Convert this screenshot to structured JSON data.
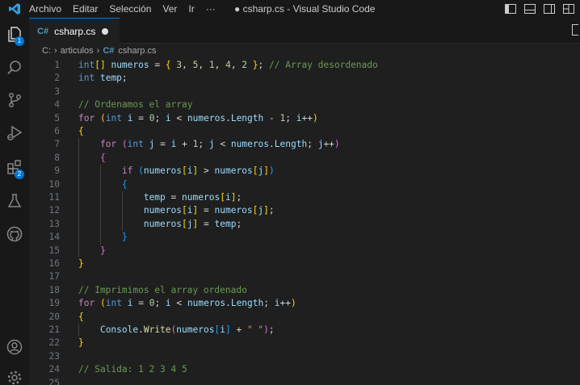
{
  "window": {
    "title": "● csharp.cs - Visual Studio Code"
  },
  "menu": {
    "items": [
      "Archivo",
      "Editar",
      "Selección",
      "Ver",
      "Ir",
      "···"
    ]
  },
  "activity": {
    "explorer_badge": "1",
    "extensions_badge": "2",
    "icons": [
      "files-icon",
      "search-icon",
      "source-control-icon",
      "run-debug-icon",
      "extensions-icon",
      "testing-icon",
      "github-icon",
      "account-icon",
      "settings-gear-icon"
    ]
  },
  "tab": {
    "icon": "C#",
    "label": "csharp.cs",
    "dirty": true
  },
  "breadcrumb": {
    "drive": "C:",
    "folder": "articulos",
    "icon": "C#",
    "file": "csharp.cs"
  },
  "editor": {
    "line_numbers": [
      "1",
      "2",
      "3",
      "4",
      "5",
      "6",
      "7",
      "8",
      "9",
      "10",
      "11",
      "12",
      "13",
      "14",
      "15",
      "16",
      "17",
      "18",
      "19",
      "20",
      "21",
      "22",
      "23",
      "24",
      "25"
    ],
    "lines": [
      [
        [
          "kw",
          "int"
        ],
        [
          "b1",
          "[]"
        ],
        [
          "plain",
          " "
        ],
        [
          "var",
          "numeros"
        ],
        [
          "plain",
          " "
        ],
        [
          "op",
          "="
        ],
        [
          "plain",
          " "
        ],
        [
          "b1",
          "{"
        ],
        [
          "plain",
          " "
        ],
        [
          "num",
          "3"
        ],
        [
          "plain",
          ", "
        ],
        [
          "num",
          "5"
        ],
        [
          "plain",
          ", "
        ],
        [
          "num",
          "1"
        ],
        [
          "plain",
          ", "
        ],
        [
          "num",
          "4"
        ],
        [
          "plain",
          ", "
        ],
        [
          "num",
          "2"
        ],
        [
          "plain",
          " "
        ],
        [
          "b1",
          "}"
        ],
        [
          "plain",
          "; "
        ],
        [
          "cmt",
          "// Array desordenado"
        ]
      ],
      [
        [
          "kw",
          "int"
        ],
        [
          "plain",
          " "
        ],
        [
          "var",
          "temp"
        ],
        [
          "plain",
          ";"
        ]
      ],
      [],
      [
        [
          "cmt",
          "// Ordenamos el array"
        ]
      ],
      [
        [
          "ctl",
          "for"
        ],
        [
          "plain",
          " "
        ],
        [
          "b1",
          "("
        ],
        [
          "kw",
          "int"
        ],
        [
          "plain",
          " "
        ],
        [
          "var",
          "i"
        ],
        [
          "plain",
          " "
        ],
        [
          "op",
          "="
        ],
        [
          "plain",
          " "
        ],
        [
          "num",
          "0"
        ],
        [
          "plain",
          "; "
        ],
        [
          "var",
          "i"
        ],
        [
          "plain",
          " "
        ],
        [
          "op",
          "<"
        ],
        [
          "plain",
          " "
        ],
        [
          "var",
          "numeros"
        ],
        [
          "plain",
          "."
        ],
        [
          "var",
          "Length"
        ],
        [
          "plain",
          " "
        ],
        [
          "op",
          "-"
        ],
        [
          "plain",
          " "
        ],
        [
          "num",
          "1"
        ],
        [
          "plain",
          "; "
        ],
        [
          "var",
          "i"
        ],
        [
          "op",
          "++"
        ],
        [
          "b1",
          ")"
        ]
      ],
      [
        [
          "b1",
          "{"
        ]
      ],
      [
        [
          "plain",
          "    "
        ],
        [
          "ctl",
          "for"
        ],
        [
          "plain",
          " "
        ],
        [
          "b2",
          "("
        ],
        [
          "kw",
          "int"
        ],
        [
          "plain",
          " "
        ],
        [
          "var",
          "j"
        ],
        [
          "plain",
          " "
        ],
        [
          "op",
          "="
        ],
        [
          "plain",
          " "
        ],
        [
          "var",
          "i"
        ],
        [
          "plain",
          " "
        ],
        [
          "op",
          "+"
        ],
        [
          "plain",
          " "
        ],
        [
          "num",
          "1"
        ],
        [
          "plain",
          "; "
        ],
        [
          "var",
          "j"
        ],
        [
          "plain",
          " "
        ],
        [
          "op",
          "<"
        ],
        [
          "plain",
          " "
        ],
        [
          "var",
          "numeros"
        ],
        [
          "plain",
          "."
        ],
        [
          "var",
          "Length"
        ],
        [
          "plain",
          "; "
        ],
        [
          "var",
          "j"
        ],
        [
          "op",
          "++"
        ],
        [
          "b2",
          ")"
        ]
      ],
      [
        [
          "plain",
          "    "
        ],
        [
          "b2",
          "{"
        ]
      ],
      [
        [
          "plain",
          "        "
        ],
        [
          "ctl",
          "if"
        ],
        [
          "plain",
          " "
        ],
        [
          "b3",
          "("
        ],
        [
          "var",
          "numeros"
        ],
        [
          "b1",
          "["
        ],
        [
          "var",
          "i"
        ],
        [
          "b1",
          "]"
        ],
        [
          "plain",
          " "
        ],
        [
          "op",
          ">"
        ],
        [
          "plain",
          " "
        ],
        [
          "var",
          "numeros"
        ],
        [
          "b1",
          "["
        ],
        [
          "var",
          "j"
        ],
        [
          "b1",
          "]"
        ],
        [
          "b3",
          ")"
        ]
      ],
      [
        [
          "plain",
          "        "
        ],
        [
          "b3",
          "{"
        ]
      ],
      [
        [
          "plain",
          "            "
        ],
        [
          "var",
          "temp"
        ],
        [
          "plain",
          " "
        ],
        [
          "op",
          "="
        ],
        [
          "plain",
          " "
        ],
        [
          "var",
          "numeros"
        ],
        [
          "b1",
          "["
        ],
        [
          "var",
          "i"
        ],
        [
          "b1",
          "]"
        ],
        [
          "plain",
          ";"
        ]
      ],
      [
        [
          "plain",
          "            "
        ],
        [
          "var",
          "numeros"
        ],
        [
          "b1",
          "["
        ],
        [
          "var",
          "i"
        ],
        [
          "b1",
          "]"
        ],
        [
          "plain",
          " "
        ],
        [
          "op",
          "="
        ],
        [
          "plain",
          " "
        ],
        [
          "var",
          "numeros"
        ],
        [
          "b1",
          "["
        ],
        [
          "var",
          "j"
        ],
        [
          "b1",
          "]"
        ],
        [
          "plain",
          ";"
        ]
      ],
      [
        [
          "plain",
          "            "
        ],
        [
          "var",
          "numeros"
        ],
        [
          "b1",
          "["
        ],
        [
          "var",
          "j"
        ],
        [
          "b1",
          "]"
        ],
        [
          "plain",
          " "
        ],
        [
          "op",
          "="
        ],
        [
          "plain",
          " "
        ],
        [
          "var",
          "temp"
        ],
        [
          "plain",
          ";"
        ]
      ],
      [
        [
          "plain",
          "        "
        ],
        [
          "b3",
          "}"
        ]
      ],
      [
        [
          "plain",
          "    "
        ],
        [
          "b2",
          "}"
        ]
      ],
      [
        [
          "b1",
          "}"
        ]
      ],
      [],
      [
        [
          "cmt",
          "// Imprimimos el array ordenado"
        ]
      ],
      [
        [
          "ctl",
          "for"
        ],
        [
          "plain",
          " "
        ],
        [
          "b1",
          "("
        ],
        [
          "kw",
          "int"
        ],
        [
          "plain",
          " "
        ],
        [
          "var",
          "i"
        ],
        [
          "plain",
          " "
        ],
        [
          "op",
          "="
        ],
        [
          "plain",
          " "
        ],
        [
          "num",
          "0"
        ],
        [
          "plain",
          "; "
        ],
        [
          "var",
          "i"
        ],
        [
          "plain",
          " "
        ],
        [
          "op",
          "<"
        ],
        [
          "plain",
          " "
        ],
        [
          "var",
          "numeros"
        ],
        [
          "plain",
          "."
        ],
        [
          "var",
          "Length"
        ],
        [
          "plain",
          "; "
        ],
        [
          "var",
          "i"
        ],
        [
          "op",
          "++"
        ],
        [
          "b1",
          ")"
        ]
      ],
      [
        [
          "b1",
          "{"
        ]
      ],
      [
        [
          "plain",
          "    "
        ],
        [
          "var",
          "Console"
        ],
        [
          "plain",
          "."
        ],
        [
          "fn",
          "Write"
        ],
        [
          "b2",
          "("
        ],
        [
          "var",
          "numeros"
        ],
        [
          "b3",
          "["
        ],
        [
          "var",
          "i"
        ],
        [
          "b3",
          "]"
        ],
        [
          "plain",
          " "
        ],
        [
          "op",
          "+"
        ],
        [
          "plain",
          " "
        ],
        [
          "str",
          "\" \""
        ],
        [
          "b2",
          ")"
        ],
        [
          "plain",
          ";"
        ]
      ],
      [
        [
          "b1",
          "}"
        ]
      ],
      [],
      [
        [
          "cmt",
          "// Salida: 1 2 3 4 5"
        ]
      ],
      []
    ]
  }
}
